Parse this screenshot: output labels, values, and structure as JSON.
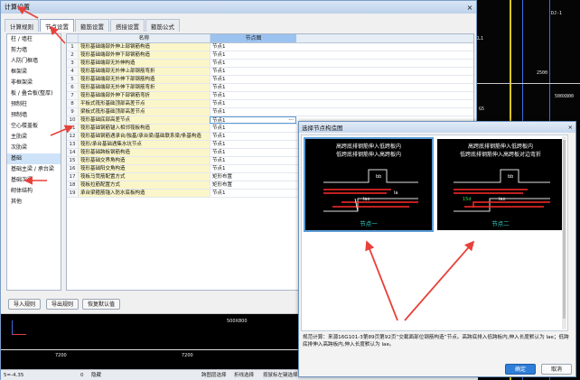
{
  "window": {
    "title": "计算设置",
    "close": "×"
  },
  "tabs": [
    {
      "label": "计算规则"
    },
    {
      "label": "节点设置"
    },
    {
      "label": "箍筋设置"
    },
    {
      "label": "搭接设置"
    },
    {
      "label": "箍筋公式"
    }
  ],
  "sidebar": {
    "items": [
      {
        "label": "柱 / 墙柱"
      },
      {
        "label": "剪力墙"
      },
      {
        "label": "人防门框墙"
      },
      {
        "label": "框架梁"
      },
      {
        "label": "非框架梁"
      },
      {
        "label": "板 / 叠合板(整厚)"
      },
      {
        "label": "预制柱"
      },
      {
        "label": "预制墙"
      },
      {
        "label": "空心楼盖板"
      },
      {
        "label": "主肋梁"
      },
      {
        "label": "次肋梁"
      },
      {
        "label": "基础"
      },
      {
        "label": "基础主梁 / 承台梁"
      },
      {
        "label": "基础次梁"
      },
      {
        "label": "砌体结构"
      },
      {
        "label": "其他"
      }
    ],
    "selected": "基础"
  },
  "grid": {
    "col_name": "名称",
    "col_node": "节点图",
    "rows": [
      {
        "n": "1",
        "name": "筏形基础端部外伸上部钢筋构造",
        "node": "节点1"
      },
      {
        "n": "2",
        "name": "筏形基础端部外伸下部钢筋构造",
        "node": "节点1"
      },
      {
        "n": "3",
        "name": "筏形基础端部无外伸构造",
        "node": "节点1"
      },
      {
        "n": "4",
        "name": "筏形基础端部无外伸上部钢筋弯折",
        "node": "节点1"
      },
      {
        "n": "5",
        "name": "筏形基础端部无外伸下部钢筋构造",
        "node": "节点1"
      },
      {
        "n": "6",
        "name": "筏形基础端部无外伸下部钢筋弯折",
        "node": "节点1"
      },
      {
        "n": "7",
        "name": "筏形基础端部外伸下部钢筋弯折",
        "node": "节点1"
      },
      {
        "n": "8",
        "name": "平板式筏形基础顶部高差节点",
        "node": "节点1"
      },
      {
        "n": "9",
        "name": "梁板式筏形基础顶部高差节点",
        "node": "节点1"
      },
      {
        "n": "10",
        "name": "筏形基础底部高差节点",
        "node": "节点1"
      },
      {
        "n": "11",
        "name": "筏形基础钢筋锚入相邻筏板构造",
        "node": "节点1"
      },
      {
        "n": "12",
        "name": "筏形基础钢筋遇承台/独基/承台梁/基础联系梁/条基构造",
        "node": "节点1"
      },
      {
        "n": "13",
        "name": "筏形/承台基础遇集水坑节点",
        "node": "节点1"
      },
      {
        "n": "14",
        "name": "筏形基础跨板钢筋构造",
        "node": "节点1"
      },
      {
        "n": "15",
        "name": "筏形基础交界角构造",
        "node": "节点1"
      },
      {
        "n": "16",
        "name": "筏形基础阳交角构造",
        "node": "节点1"
      },
      {
        "n": "17",
        "name": "筏板马凳筋配置方式",
        "node": "矩形布置"
      },
      {
        "n": "18",
        "name": "筏板拉筋配置方式",
        "node": "矩形布置"
      },
      {
        "n": "19",
        "name": "承台梁箍筋锚入防水底板构造",
        "node": "节点1"
      }
    ],
    "highlight_row": "10",
    "dots": "···"
  },
  "buttons": {
    "import": "导入规则",
    "export": "导出规则",
    "restore": "恢复默认值"
  },
  "cad": {
    "dim1": "7200",
    "dim2": "7200",
    "dim3": "500",
    "label_right": "500X800",
    "coord_labels": [
      "DJ-1",
      "KL1",
      "2500",
      "500X800",
      "G5"
    ]
  },
  "statusbar": {
    "left": "5=-4.35",
    "num": "0",
    "s1": "隐藏",
    "s2": "跨图层选择",
    "s3": "折线选择",
    "s4": "按鼠标左键选择"
  },
  "dialog": {
    "title": "选择节点构造图",
    "close": "×",
    "node1": {
      "cap1": "高跨底排钢筋伸入低跨板内",
      "cap2": "低跨底排钢筋伸入高跨板内",
      "label": "节点一",
      "dims": [
        "la",
        "bb",
        "lae"
      ]
    },
    "node2": {
      "cap1": "高跨底排钢筋伸入低跨板内",
      "cap2": "低跨底排钢筋伸入高跨板对边弯折",
      "label": "节点二",
      "dims": [
        "bb",
        "15d",
        "lae"
      ]
    },
    "note": "规范计算：来源16G101-3第89页第92页“交截面部位钢筋构造”节点。高跨底排入低跨板内,伸入长度默认为 lae；低跨底排伸入高跨板内,伸入长度默认为 lae。",
    "ok": "确定",
    "cancel": "取消"
  },
  "colors": {
    "accent": "#2f7ed8",
    "arrow": "#e8413b",
    "node_header": "#9cc3ef",
    "row_fill": "#fbf6c9",
    "rebar_red": "#ff2a2a",
    "node_label": "#34d3c8"
  }
}
